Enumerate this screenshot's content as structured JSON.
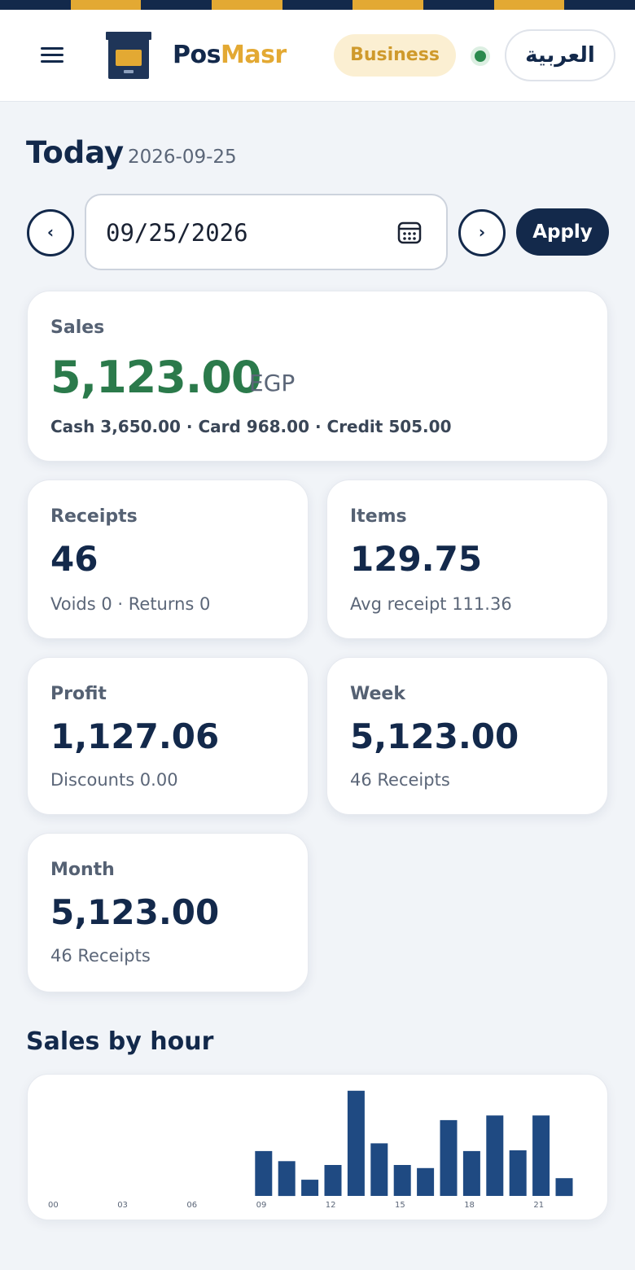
{
  "theme": {
    "navy": "#13294b",
    "gold": "#e3a933",
    "green": "#2b7a4b",
    "bar": "#1f4a82"
  },
  "header": {
    "brand_part1": "Pos",
    "brand_part2": "Masr",
    "plan_badge": "Business",
    "language_button": "العربية"
  },
  "date_bar": {
    "title": "Today",
    "date": "2026-09-25",
    "input_value": "09/25/2026",
    "prev_label": "‹",
    "next_label": "›",
    "apply_label": "Apply"
  },
  "sales": {
    "label": "Sales",
    "value": "5,123.00",
    "currency": "EGP",
    "breakdown": "Cash 3,650.00 · Card 968.00 · Credit 505.00"
  },
  "stats": [
    {
      "label": "Receipts",
      "value": "46",
      "sub": "Voids 0 · Returns 0"
    },
    {
      "label": "Items",
      "value": "129.75",
      "sub": "Avg receipt 111.36"
    },
    {
      "label": "Profit",
      "value": "1,127.06",
      "sub": "Discounts 0.00"
    },
    {
      "label": "Week",
      "value": "5,123.00",
      "sub": "46 Receipts"
    },
    {
      "label": "Month",
      "value": "5,123.00",
      "sub": "46 Receipts"
    }
  ],
  "chart_section_title": "Sales by hour",
  "chart_data": {
    "type": "bar",
    "title": "Sales by hour",
    "categories": [
      "00",
      "01",
      "02",
      "03",
      "04",
      "05",
      "06",
      "07",
      "08",
      "09",
      "10",
      "11",
      "12",
      "13",
      "14",
      "15",
      "16",
      "17",
      "18",
      "19",
      "20",
      "21",
      "22",
      "23"
    ],
    "tick_labels": [
      "00",
      "03",
      "06",
      "09",
      "12",
      "15",
      "18",
      "21"
    ],
    "values": [
      0,
      0,
      0,
      0,
      0,
      0,
      0,
      0,
      0,
      290,
      225,
      105,
      200,
      680,
      340,
      200,
      180,
      490,
      290,
      520,
      295,
      520,
      115,
      0
    ],
    "ylim": [
      0,
      700
    ],
    "grid": false,
    "legend": "none"
  }
}
